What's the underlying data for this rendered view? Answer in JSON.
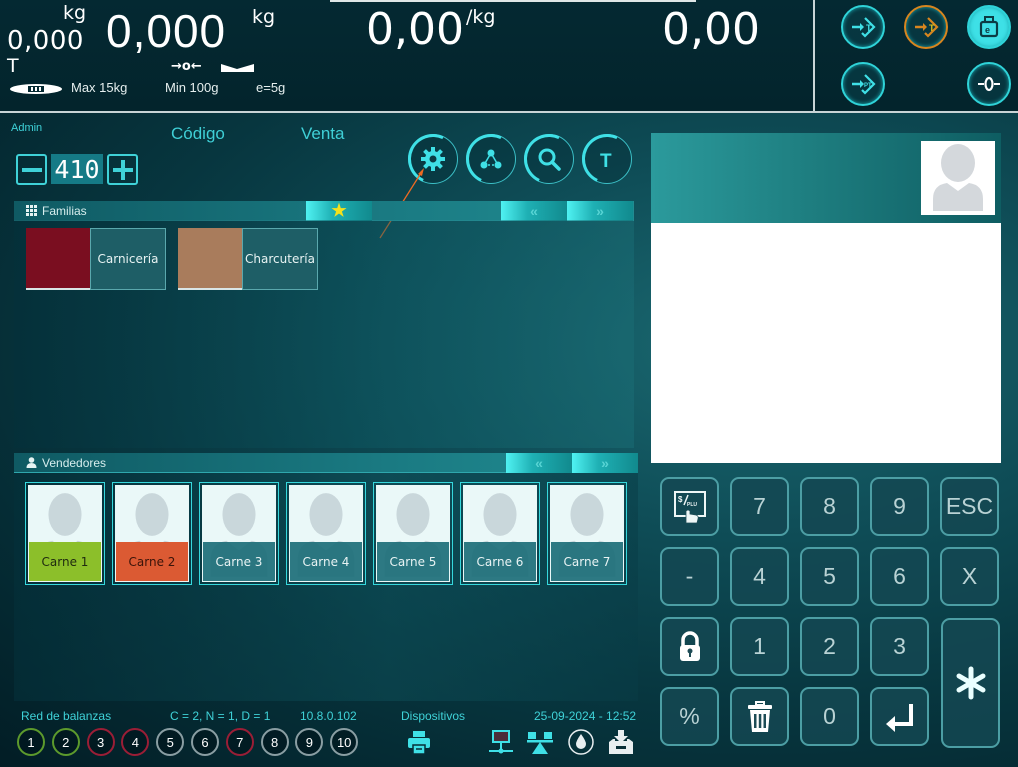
{
  "scale_display": {
    "tare_value": "0,000",
    "tare_unit": "kg",
    "tare_label": "T",
    "weight_value": "0,000",
    "weight_unit": "kg",
    "price_value": "0,00",
    "price_unit": "/kg",
    "total_value": "0,00",
    "zero_indicator": "→o←",
    "max_capacity": "Max 15kg",
    "min_capacity": "Min 100g",
    "division": "e=5g"
  },
  "top_actions": [
    {
      "name": "tare-button",
      "icon": "tare-arrow-icon"
    },
    {
      "name": "preset-tare-button",
      "icon": "tare-arrow-icon",
      "active": true,
      "accent": "#d8861f"
    },
    {
      "name": "weight-calibration-button",
      "icon": "weight-icon"
    },
    {
      "name": "fixed-tare-button",
      "icon": "fixed-tare-icon"
    },
    {
      "name": "zero-button",
      "icon": "zero-icon"
    }
  ],
  "header": {
    "user": "Admin",
    "mode_code": "Código",
    "mode_sale": "Venta",
    "stepper_value": "410",
    "stepper_minus": "—",
    "stepper_plus": "+",
    "tool_icons": [
      "settings-icon",
      "network-icon",
      "search-icon",
      "text-icon"
    ],
    "tool_text_label": "T"
  },
  "families": {
    "title": "Familias",
    "favorite_icon": "★",
    "prev": "«",
    "next": "»",
    "items": [
      {
        "name": "Carnicería",
        "color": "#7a0e20"
      },
      {
        "name": "Charcutería",
        "color": "#a97c5c"
      }
    ]
  },
  "vendors": {
    "title": "Vendedores",
    "prev": "«",
    "next": "»",
    "items": [
      {
        "name": "Carne 1",
        "status": "green"
      },
      {
        "name": "Carne 2",
        "status": "red"
      },
      {
        "name": "Carne 3",
        "status": "none"
      },
      {
        "name": "Carne 4",
        "status": "none"
      },
      {
        "name": "Carne 5",
        "status": "none"
      },
      {
        "name": "Carne 6",
        "status": "none"
      },
      {
        "name": "Carne 7",
        "status": "none"
      }
    ]
  },
  "footer": {
    "network_label": "Red de balanzas",
    "network_counts": "C = 2, N = 1, D = 1",
    "ip_address": "10.8.0.102",
    "devices_label": "Dispositivos",
    "datetime": "25-09-2024 - 12:52",
    "scales": [
      {
        "number": "1",
        "status": "green"
      },
      {
        "number": "2",
        "status": "green"
      },
      {
        "number": "3",
        "status": "red"
      },
      {
        "number": "4",
        "status": "red"
      },
      {
        "number": "5",
        "status": "none"
      },
      {
        "number": "6",
        "status": "none"
      },
      {
        "number": "7",
        "status": "red"
      },
      {
        "number": "8",
        "status": "none"
      },
      {
        "number": "9",
        "status": "none"
      },
      {
        "number": "10",
        "status": "none"
      }
    ],
    "device_icons": [
      "printer-icon",
      "network-monitor-icon",
      "balance-scale-icon",
      "ink-drop-icon",
      "download-tray-icon"
    ]
  },
  "keypad": {
    "keys": [
      "$/PLU",
      "7",
      "8",
      "9",
      "ESC",
      "-",
      "4",
      "5",
      "6",
      "X",
      "lock",
      "1",
      "2",
      "3",
      "*",
      "%",
      "delete",
      "0",
      "enter"
    ],
    "plu_label": "$/PLU",
    "esc": "ESC",
    "minus": "-",
    "multiply": "X",
    "percent": "%",
    "digits": {
      "0": "0",
      "1": "1",
      "2": "2",
      "3": "3",
      "4": "4",
      "5": "5",
      "6": "6",
      "7": "7",
      "8": "8",
      "9": "9"
    }
  },
  "colors": {
    "accent": "#3fd2d8",
    "active_vendor": "#8cbf2a",
    "busy_vendor": "#db5a33",
    "orange_action": "#d8861f"
  }
}
